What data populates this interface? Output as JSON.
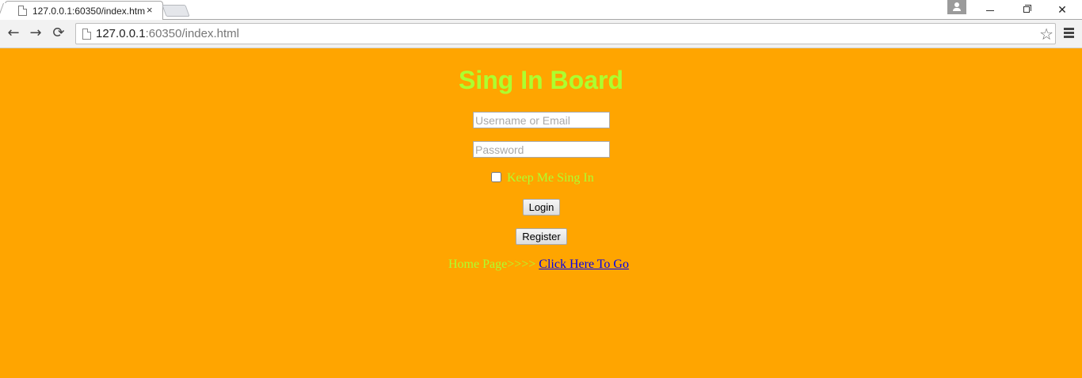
{
  "browser": {
    "tab_title": "127.0.0.1:60350/index.htm",
    "tab_close": "×",
    "url_host": "127.0.0.1",
    "url_rest": ":60350/index.html",
    "back_glyph": "←",
    "forward_glyph": "→",
    "reload_glyph": "⟳",
    "star_glyph": "☆",
    "window_close_glyph": "✕",
    "icons": [
      "file-icon",
      "back-arrow-icon",
      "forward-arrow-icon",
      "reload-icon",
      "star-icon",
      "menu-icon",
      "profile-icon"
    ]
  },
  "page": {
    "background_color": "#ffa500",
    "accent_color": "#adff2f",
    "title": "Sing In Board",
    "username_placeholder": "Username or Email",
    "password_placeholder": "Password",
    "remember_label": "Keep Me Sing In",
    "login_label": "Login",
    "register_label": "Register",
    "home_prefix": "Home Page>>>>",
    "home_link": "Click Here To Go"
  }
}
